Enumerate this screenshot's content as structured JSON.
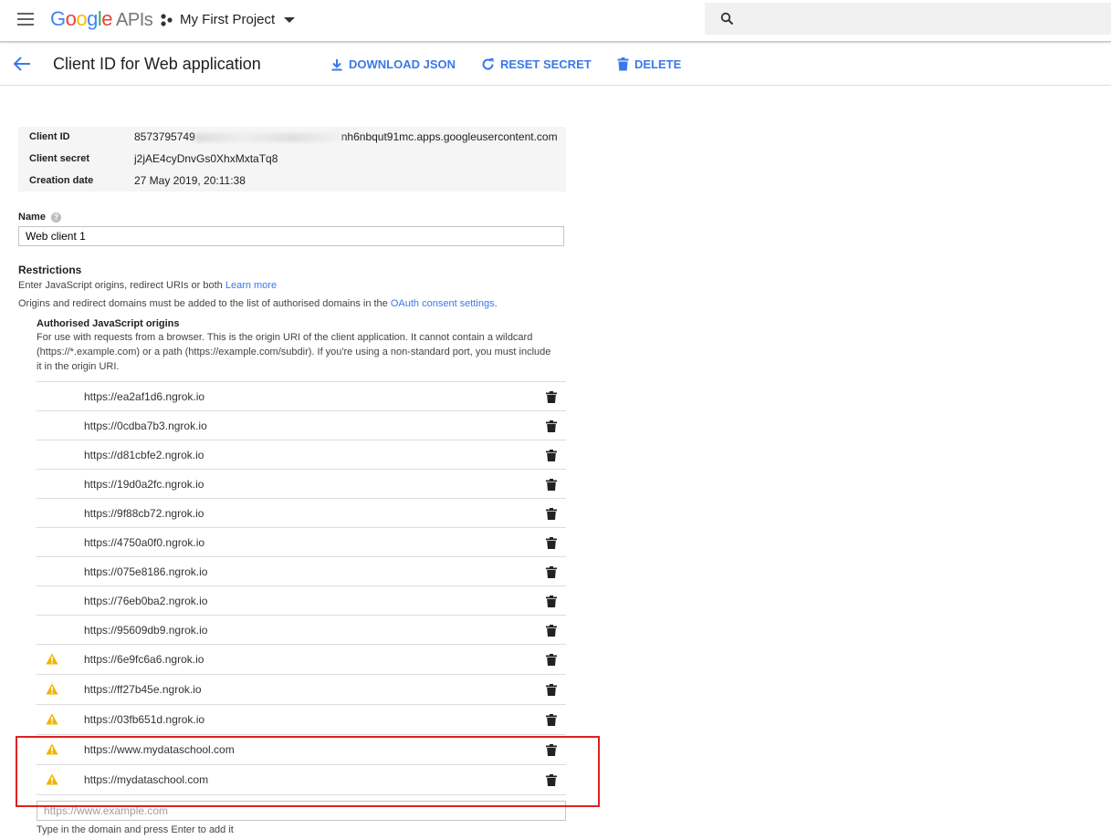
{
  "header": {
    "logo": {
      "brand": "Google",
      "suffix": "APIs"
    },
    "project": "My First Project",
    "search_placeholder": ""
  },
  "subheader": {
    "title": "Client ID for Web application",
    "download": "DOWNLOAD JSON",
    "reset": "RESET SECRET",
    "delete": "DELETE"
  },
  "info": {
    "client_id_label": "Client ID",
    "client_id_prefix": "8573795749",
    "client_id_suffix": "nh6nbqut91mc.apps.googleusercontent.com",
    "client_secret_label": "Client secret",
    "client_secret": "j2jAE4cyDnvGs0XhxMxtaTq8",
    "creation_label": "Creation date",
    "creation_date": "27 May 2019, 20:11:38"
  },
  "name": {
    "label": "Name",
    "value": "Web client 1"
  },
  "restrictions": {
    "title": "Restrictions",
    "line1": "Enter JavaScript origins, redirect URIs or both",
    "learn_more": "Learn more",
    "line2_prefix": "Origins and redirect domains must be added to the list of authorised domains in the",
    "oauth_link": "OAuth consent settings",
    "line2_suffix": ".",
    "origins_title": "Authorised JavaScript origins",
    "origins_desc": "For use with requests from a browser. This is the origin URI of the client application. It cannot contain a wildcard (https://*.example.com) or a path (https://example.com/subdir). If you're using a non-standard port, you must include it in the origin URI."
  },
  "origins": [
    {
      "url": "https://ea2af1d6.ngrok.io",
      "warning": false
    },
    {
      "url": "https://0cdba7b3.ngrok.io",
      "warning": false
    },
    {
      "url": "https://d81cbfe2.ngrok.io",
      "warning": false
    },
    {
      "url": "https://19d0a2fc.ngrok.io",
      "warning": false
    },
    {
      "url": "https://9f88cb72.ngrok.io",
      "warning": false
    },
    {
      "url": "https://4750a0f0.ngrok.io",
      "warning": false
    },
    {
      "url": "https://075e8186.ngrok.io",
      "warning": false
    },
    {
      "url": "https://76eb0ba2.ngrok.io",
      "warning": false
    },
    {
      "url": "https://95609db9.ngrok.io",
      "warning": false
    },
    {
      "url": "https://6e9fc6a6.ngrok.io",
      "warning": true
    },
    {
      "url": "https://ff27b45e.ngrok.io",
      "warning": true
    },
    {
      "url": "https://03fb651d.ngrok.io",
      "warning": true
    },
    {
      "url": "https://www.mydataschool.com",
      "warning": true
    },
    {
      "url": "https://mydataschool.com",
      "warning": true
    }
  ],
  "new_origin": {
    "placeholder": "https://www.example.com",
    "hint": "Type in the domain and press Enter to add it"
  },
  "colors": {
    "accent": "#3b78e7",
    "warning": "#f4b400",
    "highlight": "#e02020"
  }
}
